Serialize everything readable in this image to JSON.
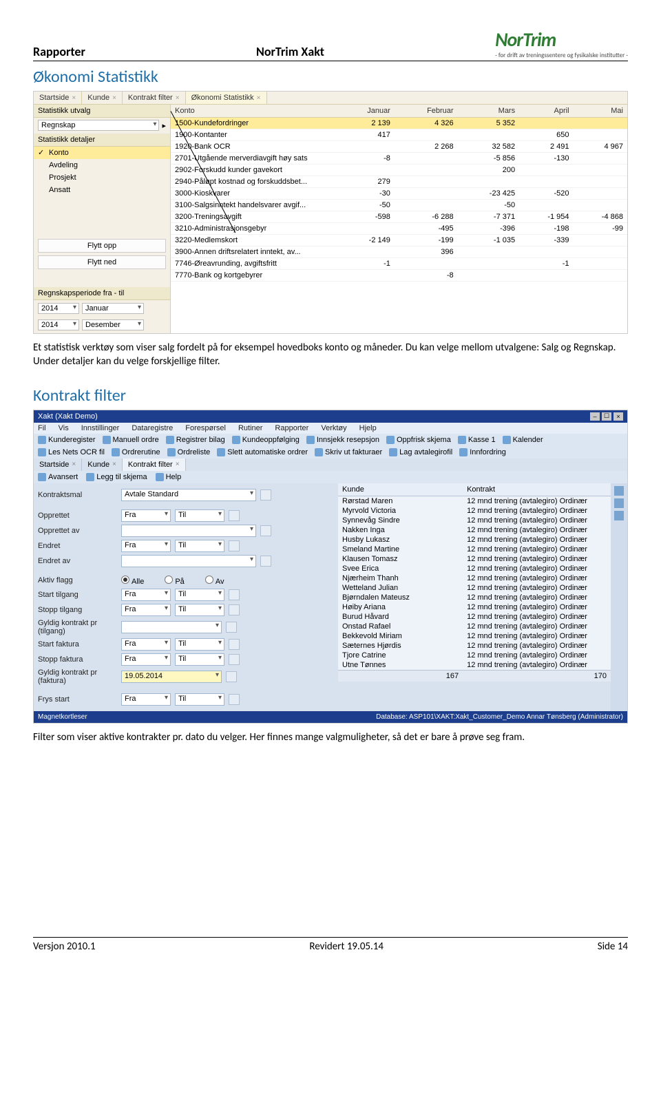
{
  "header": {
    "left": "Rapporter",
    "mid": "NorTrim Xakt",
    "logo": "NorTrim",
    "logo_sub": "- for drift av treningssentere og fysikalske institutter -"
  },
  "section1": "Økonomi Statistikk",
  "section2": "Kontrakt filter",
  "shot1": {
    "tabs": [
      "Startside",
      "Kunde",
      "Kontrakt filter",
      "Økonomi Statistikk"
    ],
    "sb_h1": "Statistikk utvalg",
    "sb_sel": "Regnskap",
    "sb_h2": "Statistikk detaljer",
    "sb_items": [
      "Konto",
      "Avdeling",
      "Prosjekt",
      "Ansatt"
    ],
    "btn_up": "Flytt opp",
    "btn_down": "Flytt ned",
    "sb_h3": "Regnskapsperiode fra - til",
    "year1": "2014",
    "mon1": "Januar",
    "year2": "2014",
    "mon2": "Desember",
    "cols": [
      "Konto",
      "Januar",
      "Februar",
      "Mars",
      "April",
      "Mai"
    ],
    "rows": [
      {
        "k": "1500-Kundefordringer",
        "v": [
          "2 139",
          "4 326",
          "5 352",
          "",
          ""
        ],
        "hl": true
      },
      {
        "k": "1900-Kontanter",
        "v": [
          "417",
          "",
          "",
          "650",
          ""
        ]
      },
      {
        "k": "1920-Bank OCR",
        "v": [
          "",
          "2 268",
          "32 582",
          "2 491",
          "4 967"
        ]
      },
      {
        "k": "2701-Utgående merverdiavgift høy sats",
        "v": [
          "-8",
          "",
          "-5 856",
          "-130",
          ""
        ]
      },
      {
        "k": "2902-Forskudd kunder gavekort",
        "v": [
          "",
          "",
          "200",
          "",
          ""
        ]
      },
      {
        "k": "2940-Påløpt kostnad og forskuddsbet...",
        "v": [
          "279",
          "",
          "",
          "",
          ""
        ]
      },
      {
        "k": "3000-Kioskvarer",
        "v": [
          "-30",
          "",
          "-23 425",
          "-520",
          ""
        ]
      },
      {
        "k": "3100-Salgsinntekt handelsvarer avgif...",
        "v": [
          "-50",
          "",
          "-50",
          "",
          ""
        ]
      },
      {
        "k": "3200-Treningsavgift",
        "v": [
          "-598",
          "-6 288",
          "-7 371",
          "-1 954",
          "-4 868"
        ]
      },
      {
        "k": "3210-Administrasjonsgebyr",
        "v": [
          "",
          "-495",
          "-396",
          "-198",
          "-99"
        ]
      },
      {
        "k": "3220-Medlemskort",
        "v": [
          "-2 149",
          "-199",
          "-1 035",
          "-339",
          ""
        ]
      },
      {
        "k": "3900-Annen driftsrelatert inntekt, av...",
        "v": [
          "",
          "396",
          "",
          "",
          ""
        ]
      },
      {
        "k": "7746-Øreavrunding, avgiftsfritt",
        "v": [
          "-1",
          "",
          "",
          "-1",
          ""
        ]
      },
      {
        "k": "7770-Bank og kortgebyrer",
        "v": [
          "",
          "-8",
          "",
          "",
          ""
        ]
      }
    ]
  },
  "para1": "Et statistisk verktøy som viser salg fordelt på for eksempel hovedboks konto og måneder. Du kan velge mellom utvalgene: Salg og Regnskap. Under detaljer kan du velge forskjellige filter.",
  "shot2": {
    "title": "Xakt (Xakt Demo)",
    "menu": [
      "Fil",
      "Vis",
      "Innstillinger",
      "Dataregistre",
      "Forespørsel",
      "Rutiner",
      "Rapporter",
      "Verktøy",
      "Hjelp"
    ],
    "toolbar1": [
      "Kunderegister",
      "Manuell ordre",
      "Registrer bilag",
      "Kundeoppfølging",
      "Innsjekk resepsjon",
      "Oppfrisk skjema",
      "Kasse 1",
      "Kalender"
    ],
    "toolbar2": [
      "Les Nets OCR fil",
      "Ordrerutine",
      "Ordreliste",
      "Slett automatiske ordrer",
      "Skriv ut fakturaer",
      "Lag avtalegirofil",
      "Innfordring"
    ],
    "tabs": [
      "Startside",
      "Kunde",
      "Kontrakt filter"
    ],
    "sub": [
      "Avansert",
      "Legg til skjema",
      "Help"
    ],
    "form": {
      "kontraktsmal_lbl": "Kontraktsmal",
      "kontraktsmal_val": "Avtale Standard",
      "opprettet": "Opprettet",
      "opprettet_av": "Opprettet av",
      "endret": "Endret",
      "endret_av": "Endret av",
      "fra": "Fra",
      "til": "Til",
      "aktiv": "Aktiv flagg",
      "alle": "Alle",
      "pa": "På",
      "av": "Av",
      "start_tilgang": "Start tilgang",
      "stopp_tilgang": "Stopp tilgang",
      "gyldig_tilgang": "Gyldig kontrakt pr (tilgang)",
      "start_faktura": "Start faktura",
      "stopp_faktura": "Stopp faktura",
      "gyldig_faktura": "Gyldig kontrakt pr (faktura)",
      "gyldig_faktura_val": "19.05.2014",
      "frys": "Frys start"
    },
    "cols": [
      "Kunde",
      "Kontrakt"
    ],
    "kunder": [
      "Rørstad Maren",
      "Myrvold Victoria",
      "Synnevåg Sindre",
      "Nakken Inga",
      "Husby Lukasz",
      "Smeland Martine",
      "Klausen Tomasz",
      "Svee Erica",
      "Njærheim Thanh",
      "Wetteland Julian",
      "Bjørndalen Mateusz",
      "Høiby Ariana",
      "Burud Håvard",
      "Onstad Rafael",
      "Bekkevold Miriam",
      "Sæternes Hjørdis",
      "Tjore Catrine",
      "Utne Tønnes"
    ],
    "kontrakt": "12 mnd trening (avtalegiro) Ordinær",
    "sum1": "167",
    "sum2": "170",
    "status_left": "Magnetkortleser",
    "status_right": "Database: ASP101\\XAKT:Xakt_Customer_Demo   Annar Tønsberg (Administrator)"
  },
  "para2": "Filter som viser aktive kontrakter pr. dato du velger. Her finnes mange valgmuligheter, så det er bare å prøve seg fram.",
  "footer": {
    "left": "Versjon 2010.1",
    "mid": "Revidert 19.05.14",
    "right": "Side 14"
  }
}
